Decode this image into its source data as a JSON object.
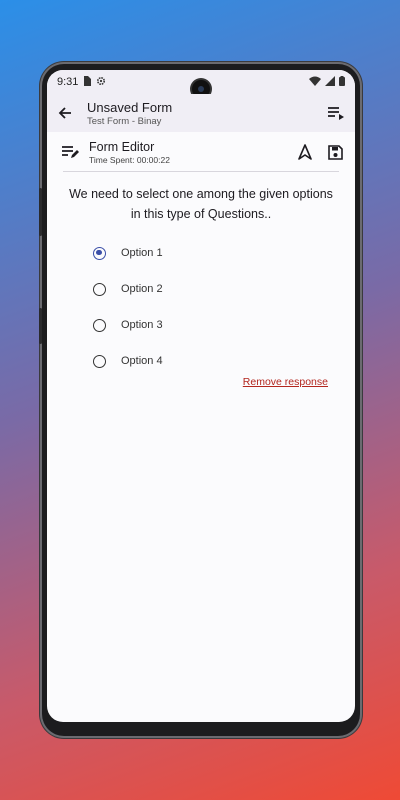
{
  "status_bar": {
    "time": "9:31"
  },
  "app_bar": {
    "title": "Unsaved Form",
    "subtitle": "Test Form - Binay"
  },
  "editor": {
    "title": "Form Editor",
    "time_spent": "Time Spent: 00:00:22"
  },
  "question": {
    "text": "We need to select one among the given options in this type of Questions..",
    "options": [
      {
        "label": "Option 1",
        "selected": true
      },
      {
        "label": "Option 2",
        "selected": false
      },
      {
        "label": "Option 3",
        "selected": false
      },
      {
        "label": "Option 4",
        "selected": false
      }
    ],
    "remove_label": "Remove response"
  },
  "colors": {
    "accent": "#3b4fa8",
    "remove": "#b3261e",
    "app_bar_bg": "#f0eef5"
  },
  "icons": {
    "back": "arrow-left-icon",
    "menu": "playlist-play-icon",
    "editor": "edit-note-icon",
    "navigate": "navigation-arrow-icon",
    "save": "save-icon"
  }
}
